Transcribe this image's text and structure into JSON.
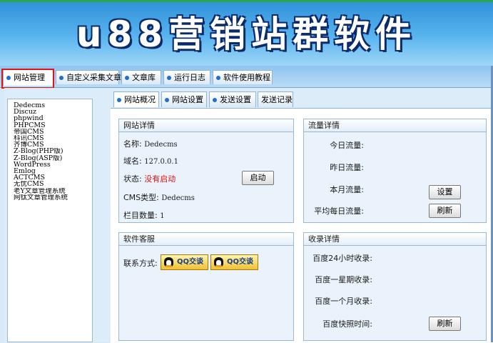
{
  "banner": {
    "title": "u88营销站群软件"
  },
  "main_tabs": [
    "网站管理",
    "自定义采集文章",
    "文章库",
    "运行日志",
    "软件使用教程"
  ],
  "site_list": [
    "Dedecms",
    "Discuz",
    "phpwind",
    "PHPCMS",
    "帝国CMS",
    "科讯CMS",
    "齐博CMS",
    "Z-Blog(PHP版)",
    "Z-Blog(ASP版)",
    "WordPress",
    "Emlog",
    "ACTCMS",
    "无忧CMS",
    "老Y文章管理系统",
    "网钛文章管理系统"
  ],
  "sub_tabs": [
    "网站概况",
    "网站设置",
    "发送设置",
    "发送记录"
  ],
  "site_details": {
    "title": "网站详情",
    "name_label": "名称:",
    "name_value": "Dedecms",
    "domain_label": "域名:",
    "domain_value": "127.0.0.1",
    "status_label": "状态:",
    "status_value": "没有启动",
    "start_button": "启动",
    "cms_label": "CMS类型:",
    "cms_value": "Dedecms",
    "column_label": "栏目数量:",
    "column_value": "1"
  },
  "traffic": {
    "title": "流量详情",
    "today": "今日流量:",
    "yesterday": "昨日流量:",
    "month": "本月流量:",
    "daily_avg": "平均每日流量:",
    "set_button": "设置",
    "refresh_button": "刷新"
  },
  "support": {
    "title": "软件客服",
    "contact_label": "联系方式:",
    "qq1": "QQ交谈",
    "qq2": "QQ交谈"
  },
  "indexing": {
    "title": "收录详情",
    "h24": "百度24小时收录:",
    "week": "百度一星期收录:",
    "month": "百度一个月收录:",
    "snapshot": "百度快照时间:",
    "refresh_button": "刷新"
  },
  "colors": {
    "accent": "#1f6fd0",
    "highlight": "#e01515",
    "status_red": "#e01010",
    "panel": "#eaf3fb"
  }
}
